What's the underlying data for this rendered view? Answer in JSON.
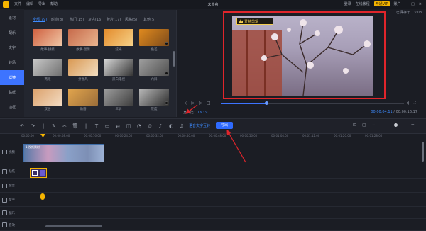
{
  "window": {
    "title": "未命名",
    "menu": [
      "文件",
      "编辑",
      "导出",
      "帮助"
    ],
    "right": [
      "登录",
      "在线教程",
      "开通VIP",
      "账户"
    ],
    "save_hint": "已保存于 13:08",
    "vip_label": "开通VIP"
  },
  "sidebar": {
    "items": [
      {
        "label": "素材"
      },
      {
        "label": "配乐"
      },
      {
        "label": "文字"
      },
      {
        "label": "转场"
      },
      {
        "label": "滤镜",
        "active": true
      },
      {
        "label": "贴纸"
      },
      {
        "label": "边框"
      }
    ]
  },
  "library": {
    "categories": [
      {
        "label": "全部(79)",
        "active": true
      },
      {
        "label": "时尚(8)"
      },
      {
        "label": "热门(15)"
      },
      {
        "label": "复古(16)"
      },
      {
        "label": "胶片(17)"
      },
      {
        "label": "风格(5)"
      },
      {
        "label": "其他(5)"
      }
    ],
    "items": [
      {
        "label": "故事·拼接",
        "c1": "#cf5f3e",
        "c2": "#f1c9a8"
      },
      {
        "label": "故事·温情",
        "c1": "#c76a4a",
        "c2": "#e9b58f"
      },
      {
        "label": "炫光",
        "c1": "#e38a2a",
        "c2": "#f6d38a"
      },
      {
        "label": "色差",
        "c1": "#e08a1e",
        "c2": "#7d4b1b"
      },
      {
        "label": "两眼",
        "c1": "#c9c9c9",
        "c2": "#6f6f6f"
      },
      {
        "label": "拼图风",
        "c1": "#d99852",
        "c2": "#f2ddc0"
      },
      {
        "label": "黑白电视",
        "c1": "#d9d9d9",
        "c2": "#333333"
      },
      {
        "label": "六屏",
        "c1": "#9f9f9f",
        "c2": "#505050"
      },
      {
        "label": "双层",
        "c1": "#dba06a",
        "c2": "#f3dcc3"
      },
      {
        "label": "角落",
        "c1": "#e2a54d",
        "c2": "#9b6e3a"
      },
      {
        "label": "三屏",
        "c1": "#9e9e9e",
        "c2": "#3e3e3e"
      },
      {
        "label": "灰度",
        "c1": "#b9b9b9",
        "c2": "#2e2e2e"
      }
    ]
  },
  "preview": {
    "sticker_text": "爱特剪辑",
    "ratio_label": "宽高比：",
    "ratio_value": "16 : 9",
    "time_current": "00:00:04.11",
    "time_total": "00:00:16.17",
    "progress": 0.25
  },
  "toolbar": {
    "tts_label": "语音文字互转",
    "export_label": "导出"
  },
  "ruler": {
    "ticks": [
      "00:00:00",
      "00:00:08.00",
      "00:00:16.00",
      "00:00:24.00",
      "00:00:32.00",
      "00:00:40.00",
      "00:00:48.00",
      "00:00:56.00",
      "00:01:04.00",
      "00:01:12.00",
      "00:01:20.00",
      "00:01:28.00"
    ]
  },
  "tracks": [
    {
      "label": "视频"
    },
    {
      "label": "贴纸"
    },
    {
      "label": "配音"
    },
    {
      "label": "文字"
    },
    {
      "label": "配乐"
    },
    {
      "label": "音效"
    }
  ],
  "timeline": {
    "video_clip_label": "1 视频素材"
  },
  "colors": {
    "accent": "#3d74ff",
    "highlight": "#e0252b",
    "vip": "#f5b400"
  }
}
